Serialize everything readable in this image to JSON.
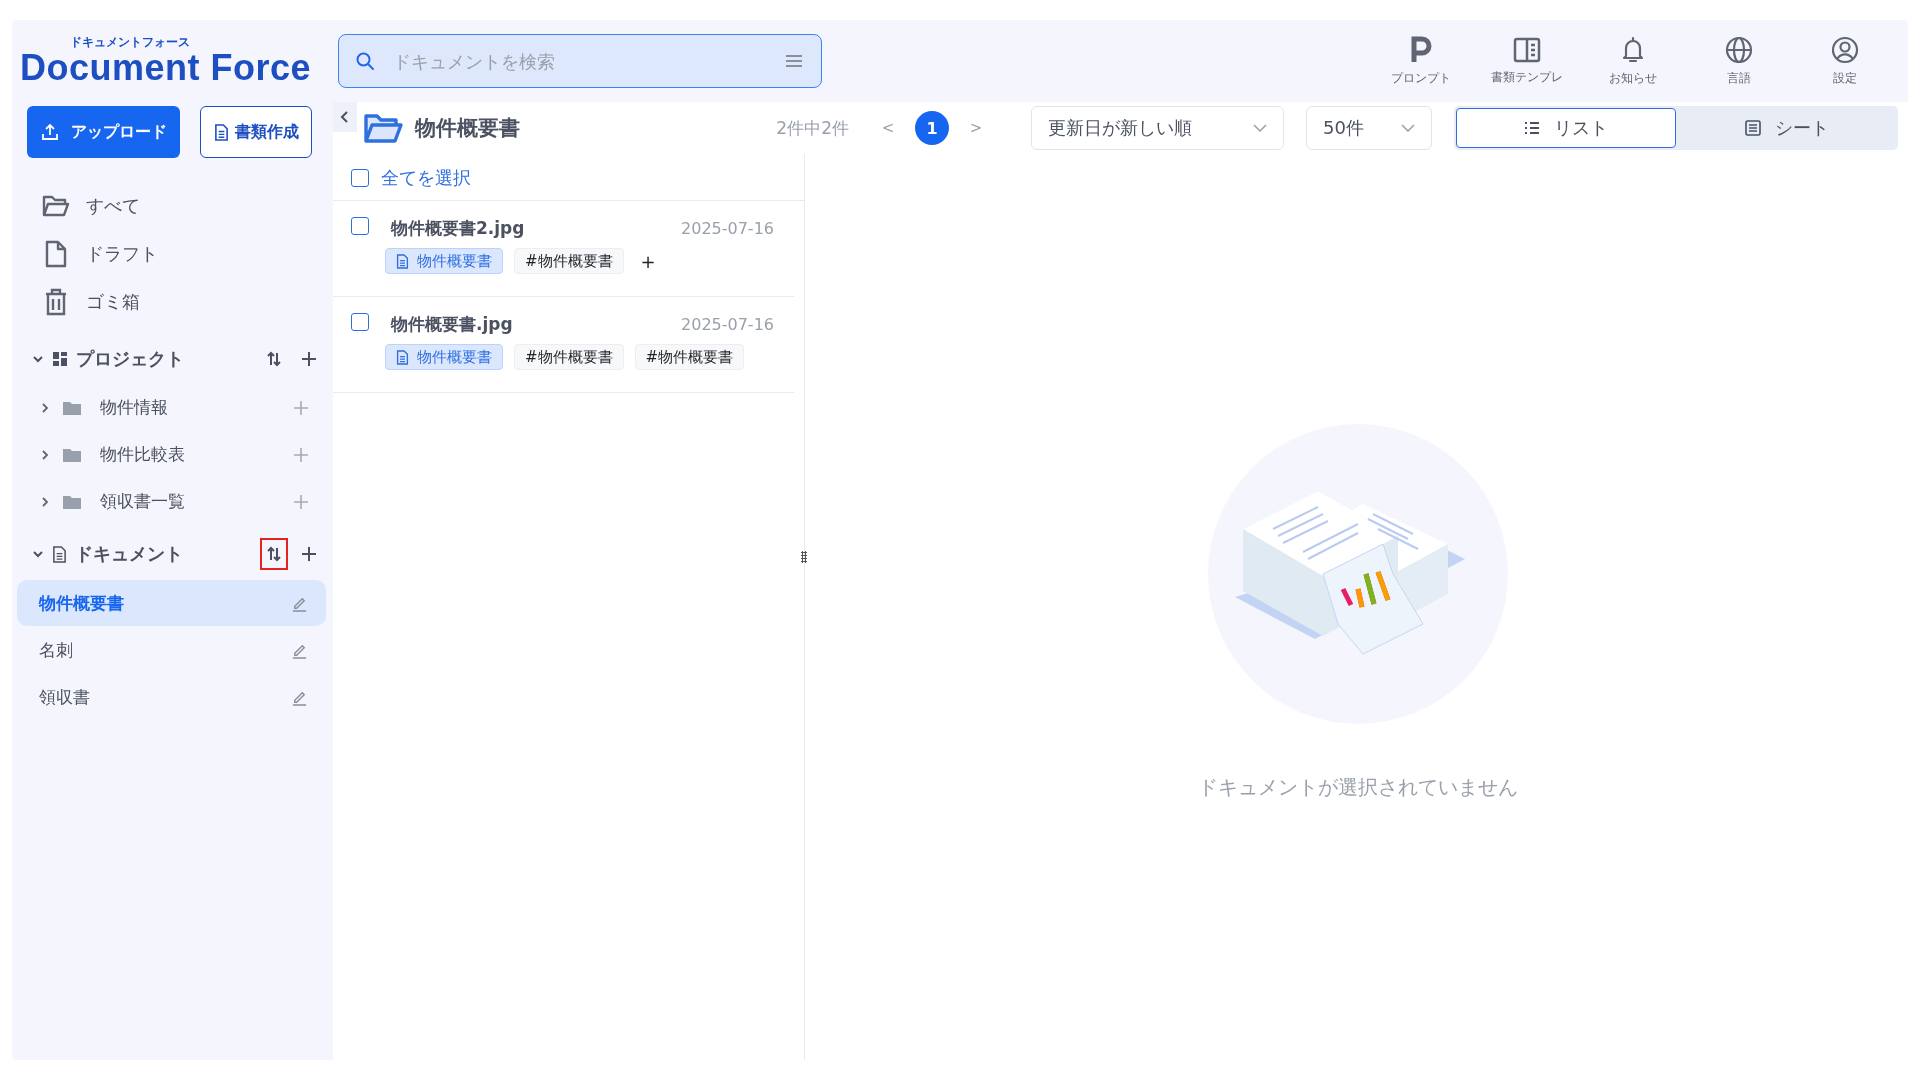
{
  "logo": {
    "kana": "ドキュメントフォース",
    "name": "Document Force"
  },
  "search": {
    "placeholder": "ドキュメントを検索"
  },
  "top_nav": [
    {
      "label": "プロンプト",
      "kind": "prompt"
    },
    {
      "label": "書類テンプレ",
      "kind": "template"
    },
    {
      "label": "お知らせ",
      "kind": "bell"
    },
    {
      "label": "言語",
      "kind": "globe"
    },
    {
      "label": "設定",
      "kind": "user"
    }
  ],
  "sidebar": {
    "buttons": [
      {
        "label": "アップロード",
        "kind": "primary"
      },
      {
        "label": "書類作成",
        "kind": "secondary"
      }
    ],
    "nav": [
      {
        "label": "すべて",
        "kind": "folder"
      },
      {
        "label": "ドラフト",
        "kind": "file"
      },
      {
        "label": "ゴミ箱",
        "kind": "trash"
      }
    ],
    "sections": [
      {
        "title": "プロジェクト",
        "kind": "project",
        "expanded": true,
        "sort_highlighted": false,
        "items": [
          {
            "label": "物件情報",
            "expanded": false
          },
          {
            "label": "物件比較表",
            "expanded": false
          },
          {
            "label": "領収書一覧",
            "expanded": false
          }
        ]
      },
      {
        "title": "ドキュメント",
        "kind": "document",
        "expanded": true,
        "sort_highlighted": true,
        "items": [
          {
            "label": "物件概要書",
            "selected": true
          },
          {
            "label": "名刺",
            "selected": false
          },
          {
            "label": "領収書",
            "selected": false
          }
        ]
      }
    ]
  },
  "toolbar": {
    "title": "物件概要書",
    "count": "2件中2件",
    "prev": "<",
    "pages": [
      {
        "label": "1",
        "selected": true
      }
    ],
    "next": ">",
    "sort": "更新日が新しい順",
    "page_size": "50件",
    "views": [
      {
        "label": "リスト",
        "kind": "list",
        "selected": true
      },
      {
        "label": "シート",
        "kind": "sheet",
        "selected": false
      }
    ]
  },
  "list": {
    "select_all": {
      "label": "全てを選択",
      "checked": false
    },
    "rows": [
      {
        "name": "物件概要書2.jpg",
        "date": "2025-07-16",
        "checked": false,
        "tags": [
          {
            "label": "物件概要書",
            "kind": "doctype"
          },
          {
            "label": "#物件概要書",
            "kind": "hashtag"
          },
          {
            "label": "+",
            "kind": "add"
          }
        ]
      },
      {
        "name": "物件概要書.jpg",
        "date": "2025-07-16",
        "checked": false,
        "tags": [
          {
            "label": "物件概要書",
            "kind": "doctype"
          },
          {
            "label": "#物件概要書",
            "kind": "hashtag"
          },
          {
            "label": "#物件概要書",
            "kind": "hashtag"
          }
        ]
      }
    ]
  },
  "empty_state": {
    "message": "ドキュメントが選択されていません"
  }
}
